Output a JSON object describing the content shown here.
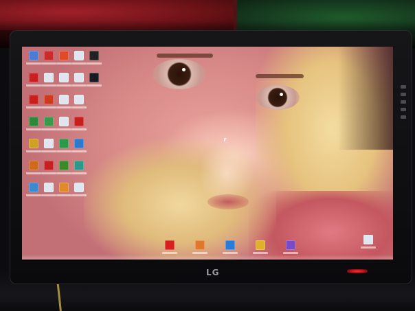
{
  "monitor": {
    "brand_logo": "LG"
  },
  "colors": {
    "skin": "#e9a29c",
    "hair": "#f1d79d",
    "sweater": "#e07a82",
    "power_led": "#ff3030"
  },
  "desktop": {
    "left_icon_grid": [
      {
        "icon": "file-icon",
        "color": "#4a7bd6"
      },
      {
        "icon": "app-icon",
        "color": "#cc2a2a"
      },
      {
        "icon": "chrome-icon",
        "color": "#e04a2a"
      },
      {
        "icon": "document-icon",
        "color": "#dfe6f0"
      },
      {
        "icon": "media-icon",
        "color": "#222222"
      },
      {
        "icon": "game-icon",
        "color": "#c82020"
      },
      {
        "icon": "document-icon",
        "color": "#dfe6f0"
      },
      {
        "icon": "document-icon",
        "color": "#dfe6f0"
      },
      {
        "icon": "document-icon",
        "color": "#dfe6f0"
      },
      {
        "icon": "folder-icon",
        "color": "#1a1a22"
      },
      {
        "icon": "pdf-icon",
        "color": "#c81e1e"
      },
      {
        "icon": "app-icon",
        "color": "#d03a1a"
      },
      {
        "icon": "document-icon",
        "color": "#dfe6f0"
      },
      {
        "icon": "document-icon",
        "color": "#dfe6f0"
      },
      {
        "icon": "app-icon",
        "color": "#c8a020"
      },
      {
        "icon": "app-icon",
        "color": "#2a8a3a"
      },
      {
        "icon": "app-icon",
        "color": "#3a9a4a"
      },
      {
        "icon": "document-icon",
        "color": "#dfe6f0"
      },
      {
        "icon": "pdf-icon",
        "color": "#c81e1e"
      },
      {
        "icon": "app-icon",
        "color": "#2a6ad0"
      },
      {
        "icon": "app-icon",
        "color": "#d0a020"
      },
      {
        "icon": "document-icon",
        "color": "#dfe6f0"
      },
      {
        "icon": "app-icon",
        "color": "#2a9a4a"
      },
      {
        "icon": "app-icon",
        "color": "#2a7ad0"
      },
      {
        "icon": "document-icon",
        "color": "#dfe6f0"
      },
      {
        "icon": "app-icon",
        "color": "#d06a1a"
      },
      {
        "icon": "app-icon",
        "color": "#c82020"
      },
      {
        "icon": "app-icon",
        "color": "#3a8a2a"
      },
      {
        "icon": "app-icon",
        "color": "#2a9a8a"
      },
      {
        "icon": "document-icon",
        "color": "#dfe6f0"
      },
      {
        "icon": "app-icon",
        "color": "#3a8ad0"
      },
      {
        "icon": "document-icon",
        "color": "#dfe6f0"
      },
      {
        "icon": "app-icon",
        "color": "#e08a2a"
      },
      {
        "icon": "document-icon",
        "color": "#dfe6f0"
      }
    ],
    "bottom_icons": [
      {
        "icon": "opera-icon",
        "color": "#d8201e"
      },
      {
        "icon": "firefox-icon",
        "color": "#e0782a"
      },
      {
        "icon": "ie-icon",
        "color": "#2a7ad8"
      },
      {
        "icon": "chrome-icon",
        "color": "#e0b02a"
      },
      {
        "icon": "app-icon",
        "color": "#7a4ac8"
      }
    ],
    "corner_icon": {
      "icon": "recycle-bin-icon",
      "color": "#dfe6f0"
    }
  }
}
